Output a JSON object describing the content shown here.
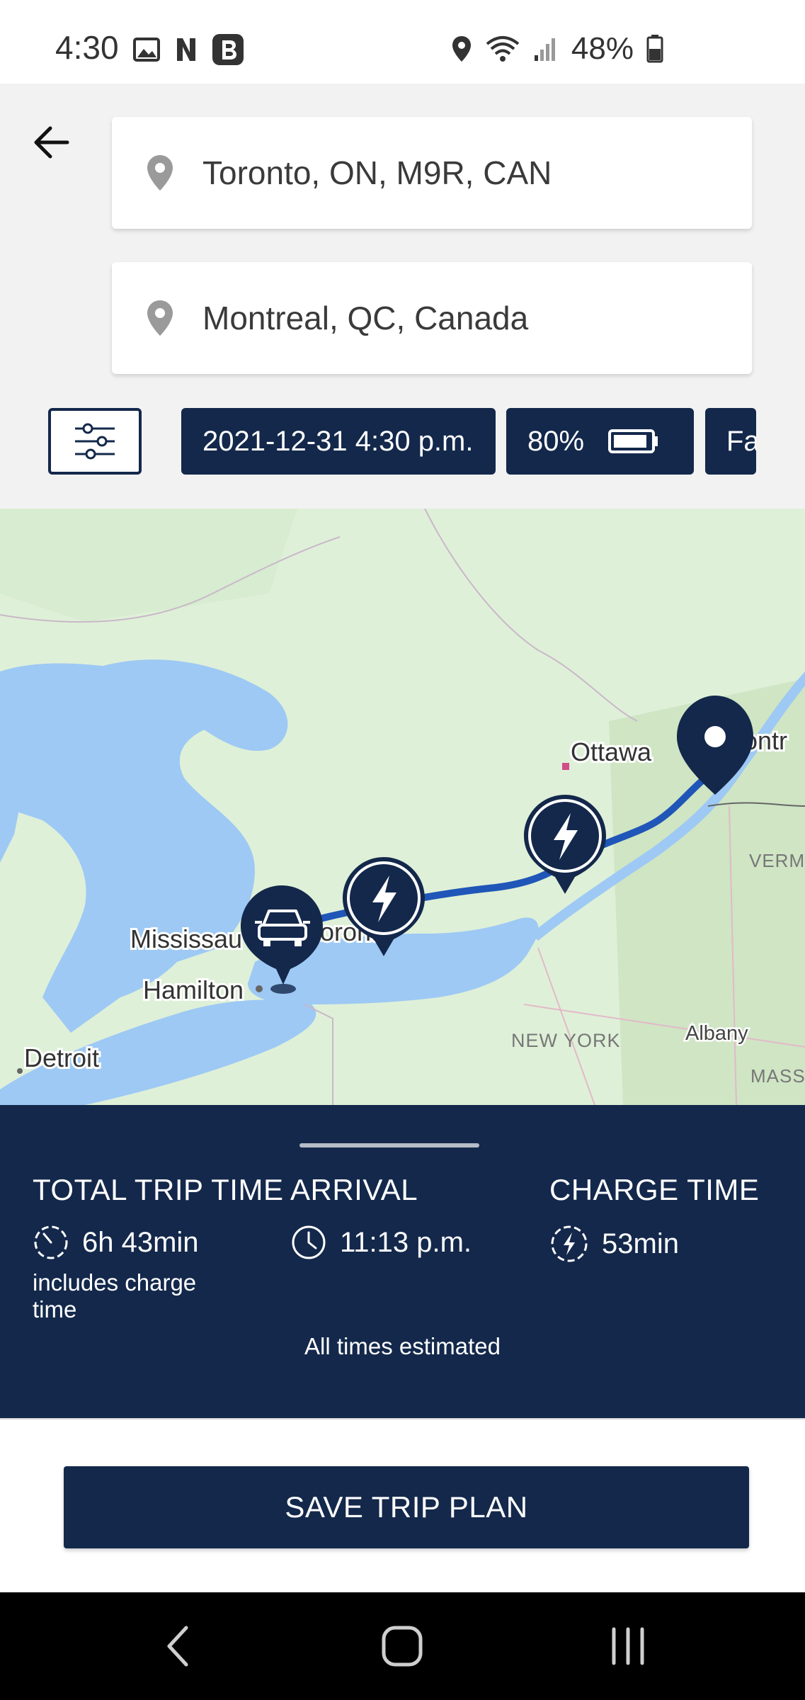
{
  "status_bar": {
    "time": "4:30",
    "battery_percent": "48%",
    "icons": [
      "gallery-icon",
      "n-app-icon",
      "b-app-icon",
      "location-icon",
      "wifi-icon",
      "signal-icon",
      "battery-icon"
    ]
  },
  "trip": {
    "origin": "Toronto, ON, M9R, CAN",
    "destination": "Montreal, QC, Canada",
    "departure_chip": "2021-12-31 4:30 p.m.",
    "charge_chip": "80%",
    "next_chip_partial": "Fa"
  },
  "map": {
    "labels": {
      "ottawa": "Ottawa",
      "montreal": "ontr",
      "mississauga": "Mississau",
      "toronto": "oronto",
      "hamilton": "Hamilton",
      "detroit": "Detroit",
      "new_york": "NEW YORK",
      "albany": "Albany",
      "vermont": "VERMO",
      "massachusetts": "MASSA"
    }
  },
  "summary": {
    "total_trip_time": {
      "title": "TOTAL TRIP TIME",
      "value": "6h 43min",
      "note": "includes charge time"
    },
    "arrival": {
      "title": "ARRIVAL",
      "value": "11:13 p.m."
    },
    "charge_time": {
      "title": "CHARGE TIME",
      "value": "53min"
    },
    "footnote": "All times estimated"
  },
  "actions": {
    "save_label": "SAVE TRIP PLAN"
  },
  "colors": {
    "navy": "#13284b",
    "route": "#1f56b8",
    "water": "#9ec9f5",
    "land": "#dff0d8"
  }
}
